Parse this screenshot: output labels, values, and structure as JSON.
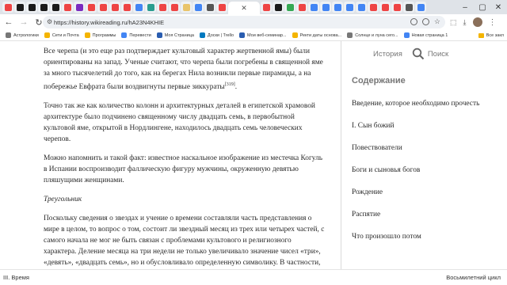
{
  "browser": {
    "url": "https://history.wikireading.ru/hA23N4KHIE",
    "tabs": [
      {
        "color": "#e44"
      },
      {
        "color": "#1b1b1b"
      },
      {
        "color": "#1b1b1b"
      },
      {
        "color": "#1b1b1b"
      },
      {
        "color": "#1b1b1b"
      },
      {
        "color": "#e44"
      },
      {
        "color": "#7b2cbf"
      },
      {
        "color": "#e44"
      },
      {
        "color": "#e44"
      },
      {
        "color": "#e44"
      },
      {
        "color": "#e44"
      },
      {
        "color": "#4285f4"
      },
      {
        "color": "#2a9d8f"
      },
      {
        "color": "#e44"
      },
      {
        "color": "#e44"
      },
      {
        "color": "#e9c46a"
      },
      {
        "color": "#4285f4"
      },
      {
        "color": "#555"
      },
      {
        "color": "#e44"
      },
      {
        "color": "#e44"
      },
      {
        "color": "#1b1b1b"
      },
      {
        "color": "#34a853"
      },
      {
        "color": "#e44"
      },
      {
        "color": "#4285f4"
      },
      {
        "color": "#4285f4"
      },
      {
        "color": "#4285f4"
      },
      {
        "color": "#4285f4"
      },
      {
        "color": "#4285f4"
      },
      {
        "color": "#e44"
      },
      {
        "color": "#e44"
      },
      {
        "color": "#e44"
      },
      {
        "color": "#555"
      },
      {
        "color": "#4285f4"
      }
    ]
  },
  "bookmarks": {
    "items": [
      {
        "label": "Астрологики",
        "color": "#777"
      },
      {
        "label": "Сети и Почта",
        "color": "#f4b400"
      },
      {
        "label": "Программы",
        "color": "#f4b400"
      },
      {
        "label": "Перевести",
        "color": "#4285f4"
      },
      {
        "label": "Моя Страница",
        "color": "#2a5db0"
      },
      {
        "label": "Доски | Trello",
        "color": "#0079bf"
      },
      {
        "label": "Мои веб-семинар...",
        "color": "#2a5db0"
      },
      {
        "label": "Ректи даты основа...",
        "color": "#f4b400"
      },
      {
        "label": "Солнце и луна сего...",
        "color": "#777"
      },
      {
        "label": "Новая страница 1",
        "color": "#4285f4"
      }
    ],
    "all_label": "Все закл"
  },
  "article": {
    "p1": "Все черепа (и это еще раз подтверждает культовый характер жертвенной ямы) были ориентированы на запад. Ученые считают, что черепа были погребены в священной яме за много тысячелетий до того, как на берегах Нила возникли первые пирамиды, а на побережье Евфрата были воздвигнуты первые зиккураты",
    "p1_ref": "[319]",
    "p1_end": ".",
    "p2": "Точно так же как количество колонн и архитектурных деталей в египетской храмовой архитектуре было подчинено священному числу двадцать семь, в первобытной культовой яме, открытой в Нордлингене, находилось двадцать семь человеческих черепов.",
    "p3": "Можно напомнить и такой факт: известное наскальное изображение из местечка Когуль в Испании воспроизводит фаллическую фигуру мужчины, окруженную девятью пляшущими женщинами.",
    "subhead": "Треугольник",
    "p4": "Поскольку сведения о звездах и учение о времени составляли часть представления о мире в целом, то вопрос о том, состоит ли звездный месяц из трех или четырех частей, с самого начала не мог не быть связан с проблемами культового и религиозного характера. Деление месяца на три недели не только увеличивало значение чисел «три», «девять», «двадцать семь», но и обусловливало определенную символику. В частности, если соединить три точки пути Луны по небу, то получится треугольник."
  },
  "sidebar": {
    "history_label": "История",
    "search_label": "Поиск",
    "toc_title": "Содержание",
    "toc": [
      "Введение, которое необходимо прочесть",
      "I. Сын божий",
      "Повествователи",
      "Боги и сыновья богов",
      "Рождение",
      "Распятие",
      "Что произошло потом"
    ]
  },
  "nav": {
    "prev": "III. Время",
    "next": "Восьмилетний цикл"
  }
}
